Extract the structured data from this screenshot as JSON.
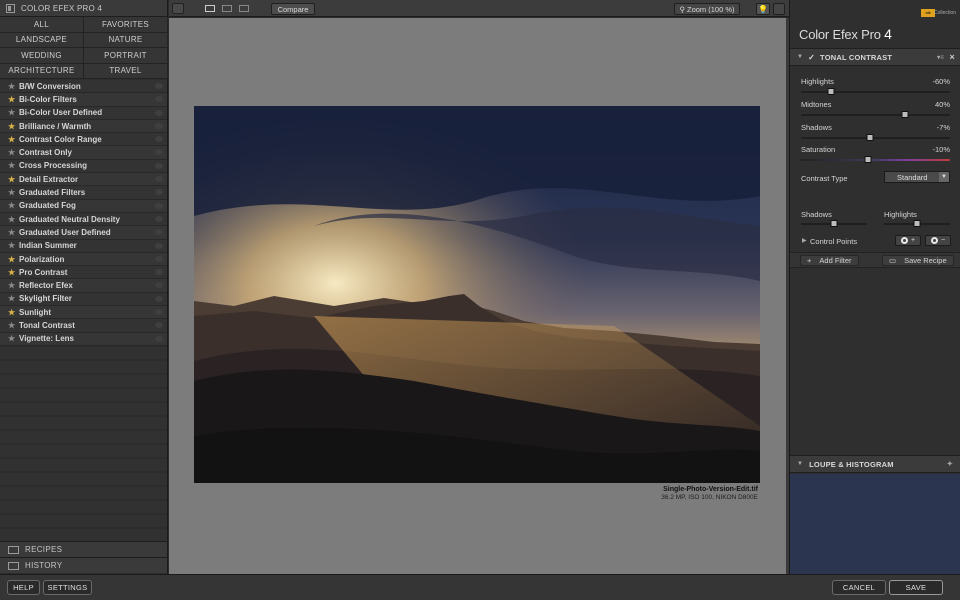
{
  "app": {
    "title": "COLOR EFEX PRO 4"
  },
  "categories": [
    "ALL",
    "FAVORITES",
    "LANDSCAPE",
    "NATURE",
    "WEDDING",
    "PORTRAIT",
    "ARCHITECTURE",
    "TRAVEL"
  ],
  "filters": [
    {
      "label": "B/W Conversion",
      "favorite": false
    },
    {
      "label": "Bi-Color Filters",
      "favorite": true
    },
    {
      "label": "Bi-Color User Defined",
      "favorite": false
    },
    {
      "label": "Brilliance / Warmth",
      "favorite": true
    },
    {
      "label": "Contrast Color Range",
      "favorite": true
    },
    {
      "label": "Contrast Only",
      "favorite": false
    },
    {
      "label": "Cross Processing",
      "favorite": false
    },
    {
      "label": "Detail Extractor",
      "favorite": true
    },
    {
      "label": "Graduated Filters",
      "favorite": false
    },
    {
      "label": "Graduated Fog",
      "favorite": false
    },
    {
      "label": "Graduated Neutral Density",
      "favorite": false
    },
    {
      "label": "Graduated User Defined",
      "favorite": false
    },
    {
      "label": "Indian Summer",
      "favorite": false
    },
    {
      "label": "Polarization",
      "favorite": true
    },
    {
      "label": "Pro Contrast",
      "favorite": true
    },
    {
      "label": "Reflector Efex",
      "favorite": false
    },
    {
      "label": "Skylight Filter",
      "favorite": false
    },
    {
      "label": "Sunlight",
      "favorite": true
    },
    {
      "label": "Tonal Contrast",
      "favorite": false
    },
    {
      "label": "Vignette: Lens",
      "favorite": false
    }
  ],
  "left_footer": {
    "recipes": "RECIPES",
    "history": "HISTORY"
  },
  "toolbar": {
    "compare": "Compare",
    "zoom": "Zoom (100 %)"
  },
  "image": {
    "filename": "Single-Photo-Version-Edit.tif",
    "meta": "36.2 MP, ISO 100, NIKON D800E"
  },
  "right": {
    "brand": "Color Efex Pro",
    "brand_num": "4",
    "badge": "nik",
    "badge_word": "Collection",
    "section": "TONAL CONTRAST",
    "sliders": [
      {
        "label": "Highlights",
        "value": "-60%",
        "pos": 0.2
      },
      {
        "label": "Midtones",
        "value": "40%",
        "pos": 0.7
      },
      {
        "label": "Shadows",
        "value": "-7%",
        "pos": 0.465
      },
      {
        "label": "Saturation",
        "value": "-10%",
        "pos": 0.45
      }
    ],
    "contrast_type_label": "Contrast Type",
    "contrast_type_value": "Standard",
    "mini": [
      {
        "label": "Shadows",
        "pos": 0.5
      },
      {
        "label": "Highlights",
        "pos": 0.5
      }
    ],
    "control_points": "Control Points",
    "add_filter": "Add Filter",
    "save_recipe": "Save Recipe",
    "loupe": "LOUPE & HISTOGRAM"
  },
  "bottom": {
    "help": "HELP",
    "settings": "SETTINGS",
    "cancel": "CANCEL",
    "save": "SAVE"
  },
  "colors": {
    "accent_star": "#d8b14a",
    "canvas_bg": "#7c7c7c",
    "loupe_bg": "#2c3550"
  }
}
